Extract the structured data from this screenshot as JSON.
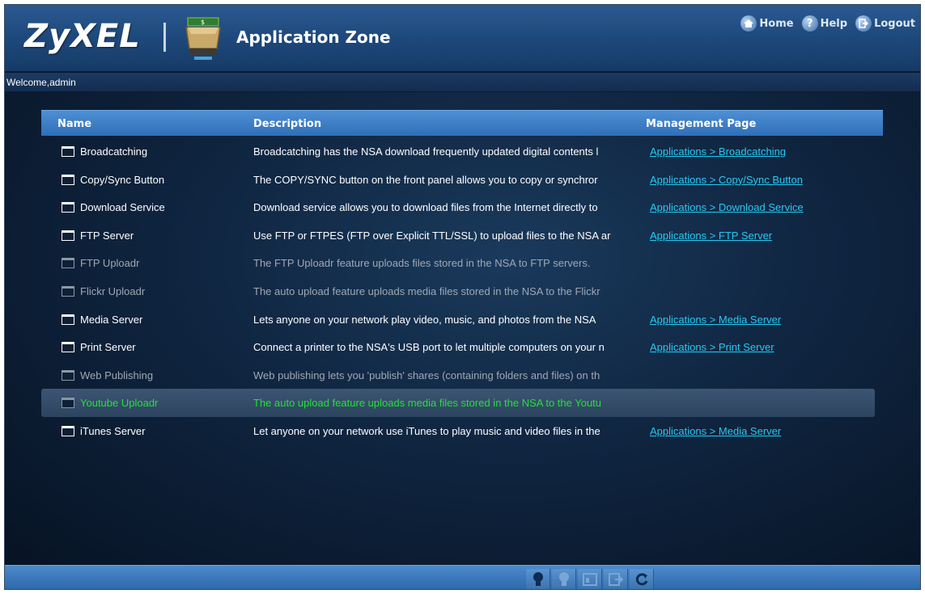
{
  "header": {
    "logo_text": "ZyXEL",
    "app_title": "Application Zone",
    "links": [
      {
        "label": "Home",
        "icon": "home-icon"
      },
      {
        "label": "Help",
        "icon": "help-icon"
      },
      {
        "label": "Logout",
        "icon": "logout-icon"
      }
    ]
  },
  "welcome": {
    "text": "Welcome,admin"
  },
  "table": {
    "columns": {
      "name": "Name",
      "description": "Description",
      "management": "Management Page"
    },
    "rows": [
      {
        "name": "Broadcatching",
        "description": "Broadcatching has the NSA download frequently updated digital contents l",
        "link": "Applications > Broadcatching",
        "state": "enabled"
      },
      {
        "name": "Copy/Sync Button",
        "description": "The COPY/SYNC button on the front panel allows you to copy or synchror",
        "link": "Applications > Copy/Sync Button",
        "state": "enabled"
      },
      {
        "name": "Download Service",
        "description": "Download service allows you to download files from the Internet directly to",
        "link": "Applications > Download Service",
        "state": "enabled"
      },
      {
        "name": "FTP Server",
        "description": "Use FTP or FTPES (FTP over Explicit TTL/SSL) to upload files to the NSA ar",
        "link": "Applications > FTP Server",
        "state": "enabled"
      },
      {
        "name": "FTP Uploadr",
        "description": "The FTP Uploadr feature uploads files stored in the NSA to FTP servers.",
        "link": "",
        "state": "disabled"
      },
      {
        "name": "Flickr Uploadr",
        "description": "The auto upload feature uploads media files stored in the NSA to the Flickr",
        "link": "",
        "state": "disabled"
      },
      {
        "name": "Media Server",
        "description": "Lets anyone on your network play video, music, and photos from the NSA",
        "link": "Applications > Media Server",
        "state": "enabled"
      },
      {
        "name": "Print Server",
        "description": "Connect a printer to the NSA's USB port to let multiple computers on your n",
        "link": "Applications > Print Server",
        "state": "enabled"
      },
      {
        "name": "Web Publishing",
        "description": "Web publishing lets you 'publish' shares (containing folders and files) on th",
        "link": "",
        "state": "disabled"
      },
      {
        "name": "Youtube Uploadr",
        "description": "The auto upload feature uploads media files stored in the NSA to the Youtu",
        "link": "",
        "state": "selected"
      },
      {
        "name": "iTunes Server",
        "description": "Let anyone on your network use iTunes to play music and video files in the",
        "link": "Applications > Media Server",
        "state": "enabled"
      }
    ]
  },
  "footer": {
    "buttons": [
      "enable-icon",
      "disable-icon",
      "window-icon",
      "export-icon",
      "refresh-icon"
    ]
  },
  "colors": {
    "link": "#27c9f0",
    "selected_text": "#22e03a",
    "header_bar": "#2f6fb8"
  }
}
